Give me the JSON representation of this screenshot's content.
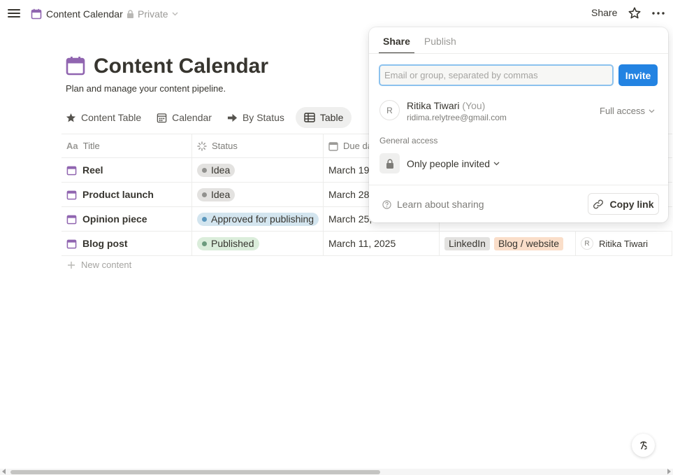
{
  "topbar": {
    "page_title": "Content Calendar",
    "privacy_label": "Private",
    "share_label": "Share"
  },
  "header": {
    "title": "Content Calendar",
    "description": "Plan and manage your content pipeline."
  },
  "views": [
    {
      "label": "Content Table",
      "icon": "star-icon",
      "active": false
    },
    {
      "label": "Calendar",
      "icon": "calendar-grid-icon",
      "active": false
    },
    {
      "label": "By Status",
      "icon": "arrow-right-icon",
      "active": false
    },
    {
      "label": "Table",
      "icon": "table-icon",
      "active": true
    }
  ],
  "table": {
    "columns": {
      "title": "Title",
      "status": "Status",
      "due": "Due da"
    },
    "rows": [
      {
        "title": "Reel",
        "status": "Idea",
        "status_color": "#e3e2e0",
        "dot_color": "#91918e",
        "due": "March 19,"
      },
      {
        "title": "Product launch",
        "status": "Idea",
        "status_color": "#e3e2e0",
        "dot_color": "#91918e",
        "due": "March 28,"
      },
      {
        "title": "Opinion piece",
        "status": "Approved for publishing",
        "status_color": "#d3e5ef",
        "dot_color": "#5b97bd",
        "due": "March 25,"
      },
      {
        "title": "Blog post",
        "status": "Published",
        "status_color": "#dbeddb",
        "dot_color": "#6c9b7d",
        "due": "March 11, 2025",
        "tags": [
          "LinkedIn",
          "Blog / website"
        ],
        "tag_colors": [
          "#e3e2e0",
          "#fadec9"
        ],
        "owner_initial": "R",
        "owner": "Ritika Tiwari"
      }
    ],
    "new_row_label": "New content"
  },
  "share_popover": {
    "tabs": [
      "Share",
      "Publish"
    ],
    "active_tab": "Share",
    "email_placeholder": "Email or group, separated by commas",
    "email_value": "",
    "invite_label": "Invite",
    "member": {
      "initial": "R",
      "name": "Ritika Tiwari",
      "you_label": "(You)",
      "email": "ridima.relytree@gmail.com",
      "access": "Full access"
    },
    "general_access_label": "General access",
    "general_access_value": "Only people invited",
    "learn_label": "Learn about sharing",
    "copy_link_label": "Copy link"
  },
  "colors": {
    "accent": "#2383e2",
    "page_icon": "#9065b0",
    "input_focus": "#8cc2ee"
  }
}
